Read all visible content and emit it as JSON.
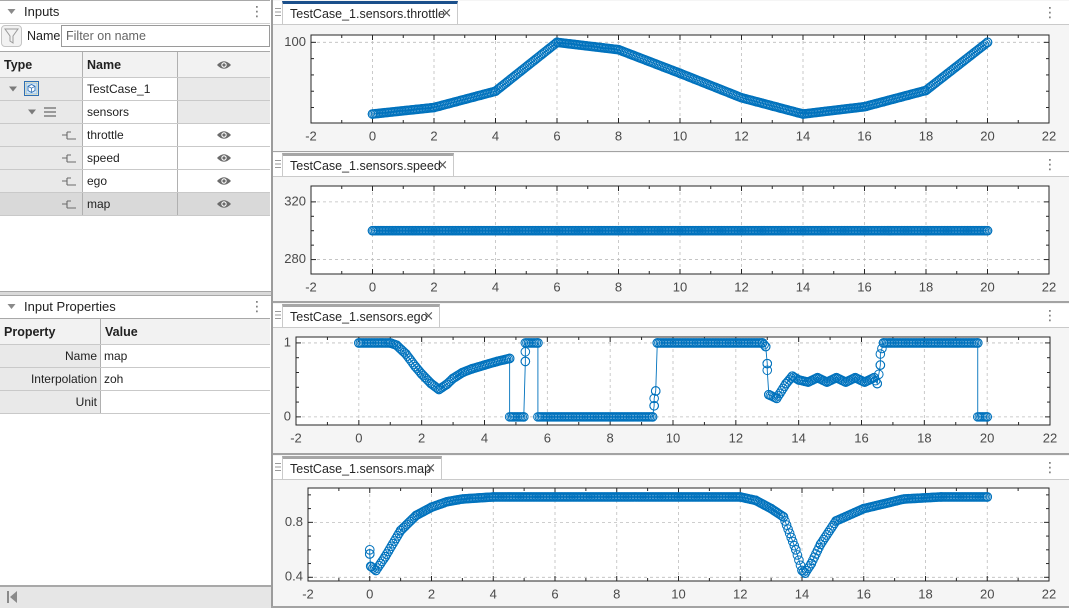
{
  "inputs_panel": {
    "title": "Inputs",
    "menu_icon": "vertical-ellipsis-icon",
    "filter": {
      "icon": "funnel-icon",
      "label": "Name",
      "placeholder": "Filter on name",
      "value": ""
    },
    "columns": {
      "type": "Type",
      "name": "Name",
      "visibility_icon": "eye-icon"
    },
    "rows": [
      {
        "name": "TestCase_1",
        "icon": "test-case-icon",
        "expanded": true
      },
      {
        "name": "sensors",
        "icon": "bus-icon",
        "expanded": true
      },
      {
        "name": "throttle",
        "icon": "signal-icon",
        "visible": true
      },
      {
        "name": "speed",
        "icon": "signal-icon",
        "visible": true
      },
      {
        "name": "ego",
        "icon": "signal-icon",
        "visible": true
      },
      {
        "name": "map",
        "icon": "signal-icon",
        "visible": true,
        "selected": true
      }
    ]
  },
  "properties_panel": {
    "title": "Input Properties",
    "menu_icon": "vertical-ellipsis-icon",
    "columns": {
      "property": "Property",
      "value": "Value"
    },
    "rows": [
      {
        "property": "Name",
        "value": "map"
      },
      {
        "property": "Interpolation",
        "value": "zoh"
      },
      {
        "property": "Unit",
        "value": ""
      }
    ]
  },
  "footer": {
    "icon": "collapse-left-icon"
  },
  "plots": [
    {
      "tab_label": "TestCase_1.sensors.throttle",
      "active": true
    },
    {
      "tab_label": "TestCase_1.sensors.speed",
      "active": false
    },
    {
      "tab_label": "TestCase_1.sensors.ego",
      "active": false
    },
    {
      "tab_label": "TestCase_1.sensors.map",
      "active": false
    }
  ],
  "colors": {
    "series": "#0072bd",
    "active_tab": "#1a4f8b",
    "inactive_tab": "#a6a6a6",
    "grid": "#bdbdbd",
    "axes": "#262626"
  },
  "chart_data": [
    {
      "type": "line",
      "title": "TestCase_1.sensors.throttle",
      "marker": "circle",
      "grid": true,
      "xlim": [
        -2,
        22
      ],
      "ylim": [
        1,
        109
      ],
      "xticks": [
        -2,
        0,
        2,
        4,
        6,
        8,
        10,
        12,
        14,
        16,
        18,
        20,
        22
      ],
      "xticks_minor": [
        -1,
        1,
        3,
        5,
        7,
        9,
        11,
        13,
        15,
        17,
        19,
        21
      ],
      "yticks": [
        100
      ],
      "yticks_minor": [
        20,
        40,
        60,
        80
      ],
      "sample_interval": 0.05,
      "series": [
        {
          "name": "throttle",
          "points": [
            [
              0,
              12
            ],
            [
              2,
              20
            ],
            [
              4,
              40
            ],
            [
              6,
              100
            ],
            [
              8,
              91
            ],
            [
              10,
              62
            ],
            [
              12,
              32
            ],
            [
              14,
              12
            ],
            [
              16,
              21
            ],
            [
              18,
              41
            ],
            [
              20,
              100
            ]
          ]
        }
      ]
    },
    {
      "type": "line",
      "title": "TestCase_1.sensors.speed",
      "marker": "circle",
      "grid": true,
      "xlim": [
        -2,
        22
      ],
      "ylim": [
        270,
        331
      ],
      "xticks": [
        -2,
        0,
        2,
        4,
        6,
        8,
        10,
        12,
        14,
        16,
        18,
        20,
        22
      ],
      "xticks_minor": [
        -1,
        1,
        3,
        5,
        7,
        9,
        11,
        13,
        15,
        17,
        19,
        21
      ],
      "yticks": [
        280,
        320
      ],
      "yticks_minor": [
        290,
        300,
        310
      ],
      "sample_interval": 0.05,
      "series": [
        {
          "name": "speed",
          "points": [
            [
              0,
              300
            ],
            [
              20,
              300
            ]
          ]
        }
      ]
    },
    {
      "type": "line",
      "title": "TestCase_1.sensors.ego",
      "marker": "circle",
      "grid": true,
      "xlim": [
        -2,
        22
      ],
      "ylim": [
        -0.11,
        1.08
      ],
      "xticks": [
        -2,
        0,
        2,
        4,
        6,
        8,
        10,
        12,
        14,
        16,
        18,
        20,
        22
      ],
      "xticks_minor": [
        -1,
        1,
        3,
        5,
        7,
        9,
        11,
        13,
        15,
        17,
        19,
        21
      ],
      "yticks": [
        0,
        1
      ],
      "yticks_minor": [
        0.2,
        0.4,
        0.6,
        0.8
      ],
      "sample_interval": 0.05,
      "series": [
        {
          "name": "ego",
          "points": [
            [
              0,
              1
            ],
            [
              1.0,
              1
            ],
            [
              1.2,
              0.97
            ],
            [
              1.5,
              0.85
            ],
            [
              1.8,
              0.68
            ],
            [
              2.0,
              0.58
            ],
            [
              2.3,
              0.45
            ],
            [
              2.55,
              0.37
            ],
            [
              2.8,
              0.44
            ],
            [
              3.0,
              0.52
            ],
            [
              3.3,
              0.6
            ],
            [
              3.6,
              0.65
            ],
            [
              4.0,
              0.7
            ],
            [
              4.4,
              0.75
            ],
            [
              4.8,
              0.79
            ],
            [
              4.8,
              0
            ],
            [
              5.25,
              0
            ],
            [
              5.3,
              0.75
            ],
            [
              5.3,
              0.88
            ],
            [
              5.3,
              1
            ],
            [
              5.7,
              1
            ],
            [
              5.7,
              0
            ],
            [
              9.35,
              0
            ],
            [
              9.4,
              0.15
            ],
            [
              9.4,
              0.25
            ],
            [
              9.45,
              0.35
            ],
            [
              9.5,
              1
            ],
            [
              12.85,
              1
            ],
            [
              12.95,
              0.95
            ],
            [
              13.0,
              0.72
            ],
            [
              13.0,
              0.63
            ],
            [
              13.05,
              0.3
            ],
            [
              13.3,
              0.25
            ],
            [
              13.6,
              0.45
            ],
            [
              13.8,
              0.55
            ],
            [
              14.0,
              0.5
            ],
            [
              14.3,
              0.47
            ],
            [
              14.6,
              0.53
            ],
            [
              14.9,
              0.47
            ],
            [
              15.2,
              0.53
            ],
            [
              15.5,
              0.47
            ],
            [
              15.8,
              0.53
            ],
            [
              16.1,
              0.47
            ],
            [
              16.4,
              0.53
            ],
            [
              16.5,
              0.45
            ],
            [
              16.6,
              0.7
            ],
            [
              16.6,
              0.85
            ],
            [
              16.7,
              1
            ],
            [
              19.7,
              1
            ],
            [
              19.7,
              0
            ],
            [
              20,
              0
            ]
          ]
        }
      ]
    },
    {
      "type": "line",
      "title": "TestCase_1.sensors.map",
      "marker": "circle",
      "grid": true,
      "xlim": [
        -2,
        22
      ],
      "ylim": [
        0.373,
        1.05
      ],
      "xticks": [
        -2,
        0,
        2,
        4,
        6,
        8,
        10,
        12,
        14,
        16,
        18,
        20,
        22
      ],
      "xticks_minor": [
        -1,
        1,
        3,
        5,
        7,
        9,
        11,
        13,
        15,
        17,
        19,
        21
      ],
      "yticks": [
        0.4,
        0.8
      ],
      "yticks_minor": [
        0.5,
        0.6,
        0.7,
        0.9,
        1.0
      ],
      "sample_interval": 0.05,
      "series": [
        {
          "name": "map",
          "points": [
            [
              0,
              0.6
            ],
            [
              0,
              0.57
            ],
            [
              0.03,
              0.48
            ],
            [
              0.2,
              0.45
            ],
            [
              0.5,
              0.55
            ],
            [
              1.0,
              0.74
            ],
            [
              1.5,
              0.85
            ],
            [
              2.0,
              0.91
            ],
            [
              2.5,
              0.95
            ],
            [
              3.0,
              0.97
            ],
            [
              4.0,
              0.985
            ],
            [
              12.0,
              0.985
            ],
            [
              12.5,
              0.96
            ],
            [
              13.0,
              0.9
            ],
            [
              13.4,
              0.84
            ],
            [
              13.8,
              0.6
            ],
            [
              14.0,
              0.45
            ],
            [
              14.1,
              0.43
            ],
            [
              14.3,
              0.5
            ],
            [
              14.6,
              0.64
            ],
            [
              15.1,
              0.81
            ],
            [
              16.0,
              0.9
            ],
            [
              17.3,
              0.97
            ],
            [
              18.5,
              0.985
            ],
            [
              20,
              0.985
            ]
          ]
        }
      ]
    }
  ]
}
